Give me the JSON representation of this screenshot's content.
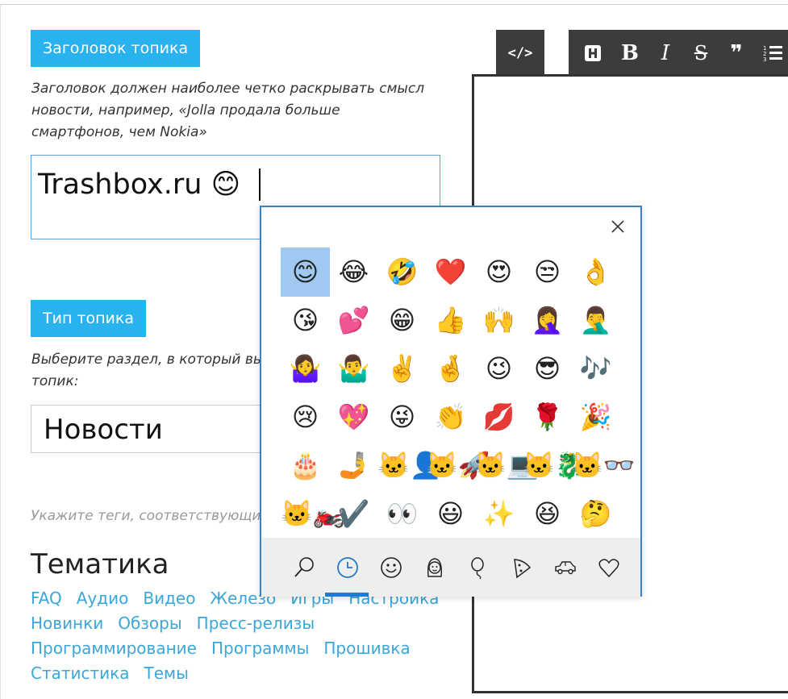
{
  "form": {
    "title_label": "Заголовок топика",
    "title_hint_lines": [
      "Заголовок должен наиболее четко раскрывать смысл",
      "новости, например, «Jolla продала больше",
      "смартфонов, чем Nokia»"
    ],
    "title_value": "Trashbox.ru 😊",
    "type_label": "Тип топика",
    "type_hint_lines": [
      "Выберите раздел, в который вы",
      "топик:"
    ],
    "type_value": "Новости",
    "tags_hint": "Укажите теги, соответствующие",
    "section_title": "Тематика",
    "tag_rows": [
      [
        "FAQ",
        "Аудио",
        "Видео",
        "Железо",
        "Игры",
        "Настройка"
      ],
      [
        "Новинки",
        "Обзоры",
        "Пресс-релизы"
      ],
      [
        "Программирование",
        "Программы",
        "Прошивка"
      ],
      [
        "Статистика",
        "Темы"
      ]
    ]
  },
  "editor_toolbar": {
    "source_icon": "code-icon",
    "buttons": [
      "heading-icon",
      "bold-icon",
      "italic-icon",
      "strikethrough-icon",
      "quote-icon",
      "numbered-list-icon"
    ],
    "source_text": "</>",
    "bold_text": "B",
    "italic_text": "I",
    "strike_text": "S",
    "quote_text": "❞"
  },
  "emoji_panel": {
    "close_icon": "close-icon",
    "emojis": [
      [
        "😊",
        "😂",
        "🤣",
        "❤️",
        "😍",
        "😒",
        "👌"
      ],
      [
        "😘",
        "💕",
        "😁",
        "👍",
        "🙌",
        "🤦‍♀️",
        "🤦‍♂️"
      ],
      [
        "🤷‍♀️",
        "🤷‍♂️",
        "✌️",
        "🤞",
        "😉",
        "😎",
        "🎶"
      ],
      [
        "😢",
        "💖",
        "😜",
        "👏",
        "💋",
        "🌹",
        "🎉"
      ],
      [
        "🎂",
        "🤳",
        "🐱‍👤",
        "🐱‍🚀",
        "🐱‍💻",
        "🐱‍🐉",
        "🐱‍👓"
      ],
      [
        "🐱‍🏍",
        "✔️",
        "👀",
        "😃",
        "✨",
        "😆",
        "🤔"
      ]
    ],
    "selected": "😊",
    "categories": [
      "search-icon",
      "recent-clock-icon",
      "smiley-icon",
      "people-icon",
      "celebration-balloon-icon",
      "food-pizza-icon",
      "transport-car-icon",
      "heart-symbols-icon"
    ],
    "active_category": "recent-clock-icon"
  },
  "colors": {
    "accent_blue": "#29b3ee",
    "link_blue": "#3aa6d9",
    "toolbar_dark": "#3c3c3c",
    "panel_border": "#3b82c4",
    "selected_cell": "#9fc9f0"
  }
}
